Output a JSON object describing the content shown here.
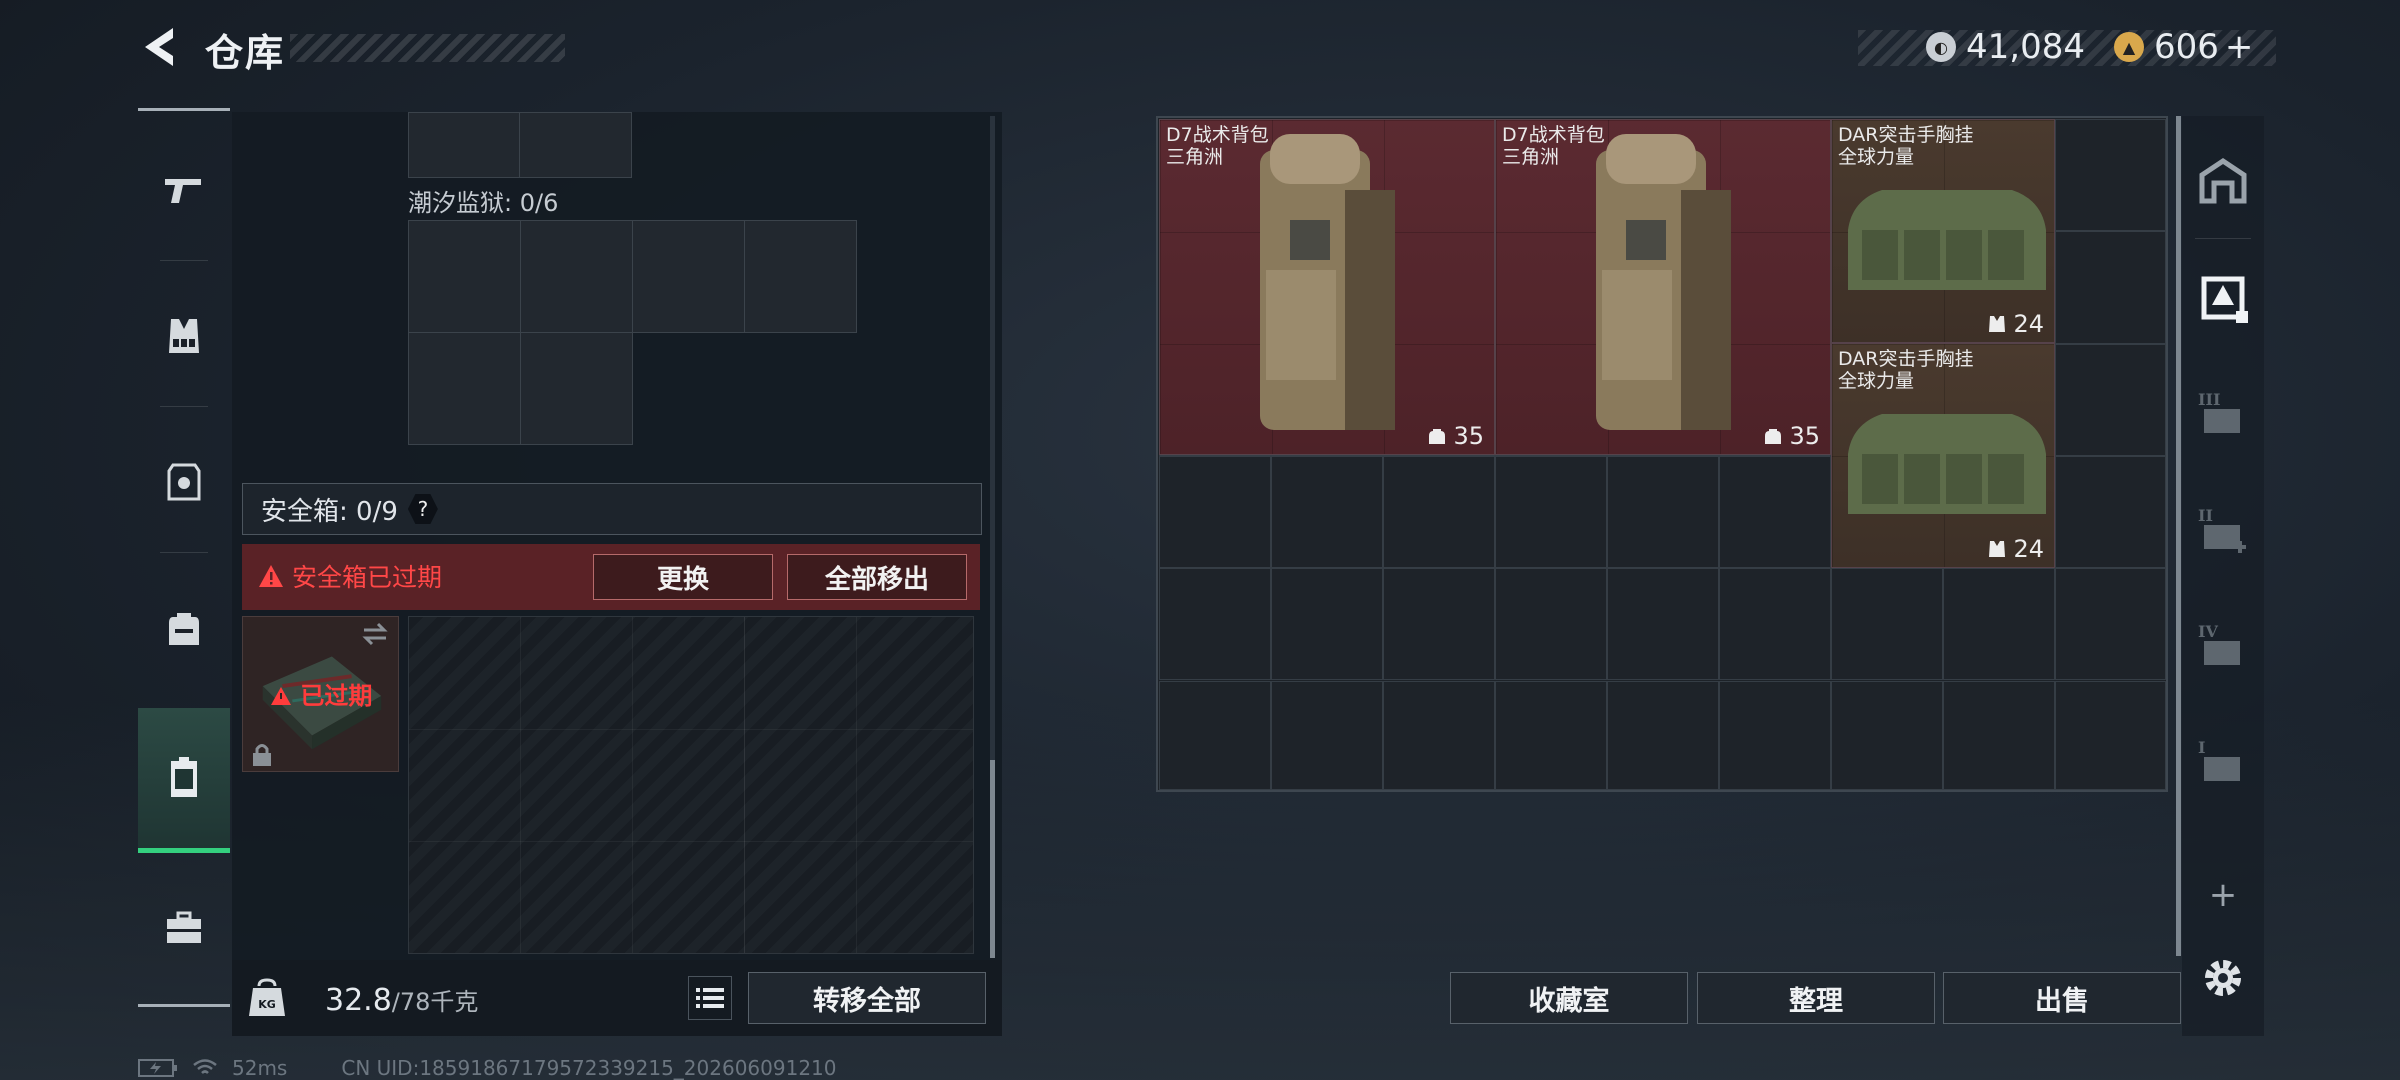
{
  "header": {
    "title": "仓库",
    "currency": [
      {
        "icon": "silver-coin-icon",
        "value": "41,084",
        "color": "#c9ced4"
      },
      {
        "icon": "gold-coin-icon",
        "value": "606",
        "color": "#d9a84c",
        "suffix": "+"
      }
    ]
  },
  "left_rail": {
    "items": [
      {
        "name": "pistol-icon"
      },
      {
        "name": "vest-icon"
      },
      {
        "name": "armor-icon"
      },
      {
        "name": "backpack-icon"
      },
      {
        "name": "safe-case-icon",
        "active": true
      },
      {
        "name": "toolbox-icon"
      }
    ]
  },
  "left_panel": {
    "container_label": "潮汐监狱: 0/6",
    "safe_box": {
      "label": "安全箱: 0/9",
      "help": "?",
      "warning": "安全箱已过期",
      "replace_button": "更换",
      "remove_all_button": "全部移出",
      "case_status": "已过期"
    },
    "weight_current": "32.8",
    "weight_max": "/78千克",
    "transfer_all_button": "转移全部"
  },
  "right_panel": {
    "items": [
      {
        "name_line1": "D7战术背包",
        "name_line2": "三角洲",
        "capacity": "35",
        "rarity_color": "#5b2a31"
      },
      {
        "name_line1": "D7战术背包",
        "name_line2": "三角洲",
        "capacity": "35",
        "rarity_color": "#5b2a31"
      },
      {
        "name_line1": "DAR突击手胸挂",
        "name_line2": "全球力量",
        "capacity": "24",
        "rarity_color": "#4a3a2e"
      },
      {
        "name_line1": "DAR突击手胸挂",
        "name_line2": "全球力量",
        "capacity": "24",
        "rarity_color": "#4a3a2e"
      }
    ],
    "buttons": {
      "collection": "收藏室",
      "organize": "整理",
      "sell": "出售"
    }
  },
  "right_rail": {
    "items": [
      {
        "name": "storage-home-icon"
      },
      {
        "name": "storage-tab-1-icon",
        "active": true
      },
      {
        "name": "storage-tab-3-icon",
        "roman": "III"
      },
      {
        "name": "storage-tab-2-icon",
        "roman": "II"
      },
      {
        "name": "storage-tab-4-icon",
        "roman": "IV"
      },
      {
        "name": "storage-tab-5-icon",
        "roman": "I"
      }
    ],
    "add": "+"
  },
  "status_bar": {
    "ping": "52ms",
    "uid": "CN UID:18591867179572339215_202606091210"
  }
}
